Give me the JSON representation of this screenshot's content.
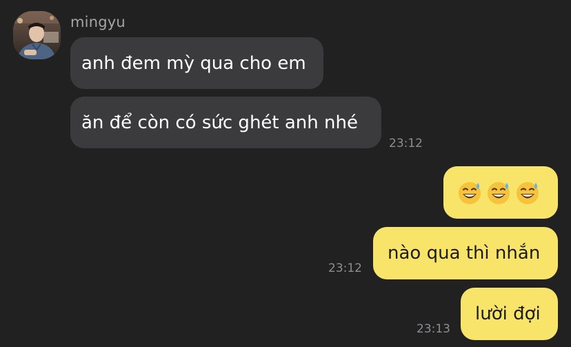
{
  "sender": {
    "name": "mingyu"
  },
  "messages": [
    {
      "direction": "incoming",
      "text": "anh đem mỳ qua cho em"
    },
    {
      "direction": "incoming",
      "text": "ăn để còn có sức ghét anh nhé",
      "time": "23:12"
    },
    {
      "direction": "outgoing",
      "emoji": [
        "grinning-sweat",
        "grinning-sweat",
        "grinning-sweat"
      ]
    },
    {
      "direction": "outgoing",
      "text": "nào qua thì nhắn",
      "time": "23:12"
    },
    {
      "direction": "outgoing",
      "text": "lười đợi",
      "time": "23:13"
    }
  ],
  "colors": {
    "background": "#212122",
    "incoming_bubble": "#3b3b3d",
    "outgoing_bubble": "#f8e468",
    "timestamp": "#8e8e92",
    "sender_name": "#a5a5a8"
  }
}
